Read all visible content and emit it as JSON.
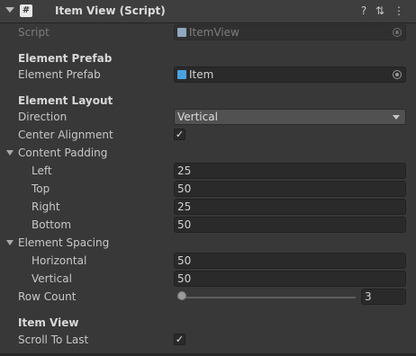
{
  "header": {
    "title": "Item View (Script)",
    "script_icon_glyph": "#",
    "help_glyph": "?",
    "presets_glyph": "⇅",
    "menu_glyph": "⋮"
  },
  "script_row": {
    "label": "Script",
    "value": "ItemView"
  },
  "element_prefab": {
    "section_label": "Element Prefab",
    "field_label": "Element Prefab",
    "value": "Item"
  },
  "element_layout": {
    "section_label": "Element Layout",
    "direction_label": "Direction",
    "direction_value": "Vertical",
    "center_alignment_label": "Center Alignment",
    "center_alignment_checked": true
  },
  "content_padding": {
    "label": "Content Padding",
    "left_label": "Left",
    "left_value": "25",
    "top_label": "Top",
    "top_value": "50",
    "right_label": "Right",
    "right_value": "25",
    "bottom_label": "Bottom",
    "bottom_value": "50"
  },
  "element_spacing": {
    "label": "Element Spacing",
    "horizontal_label": "Horizontal",
    "horizontal_value": "50",
    "vertical_label": "Vertical",
    "vertical_value": "50"
  },
  "row_count": {
    "label": "Row Count",
    "value": "3",
    "slider_fraction": 0.0
  },
  "item_view": {
    "section_label": "Item View",
    "scroll_to_last_label": "Scroll To Last",
    "scroll_to_last_checked": true
  },
  "check_glyph": "✓",
  "colors": {
    "background": "#383838",
    "header": "#3e3e3e",
    "field": "#2a2a2a",
    "dropdown": "#515151",
    "prefab_icon": "#4aa3df",
    "script_icon": "#8fa8bf"
  }
}
